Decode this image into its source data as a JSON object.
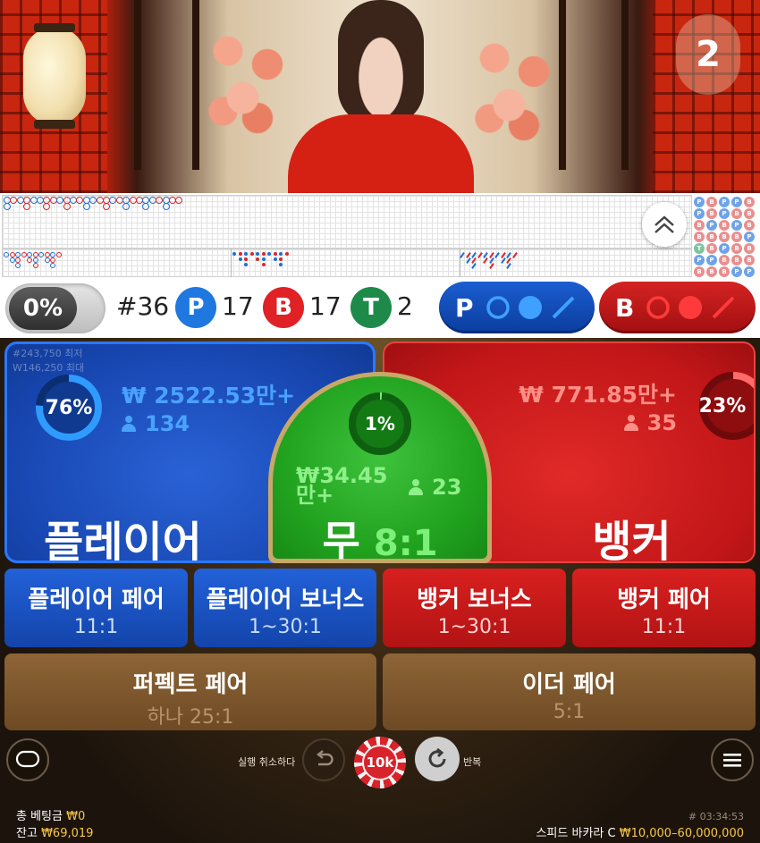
{
  "video": {
    "round_timer": "2"
  },
  "stats": {
    "percent_toggle": "0%",
    "round_number": "#36",
    "player_letter": "P",
    "player_count": "17",
    "banker_letter": "B",
    "banker_count": "17",
    "tie_letter": "T",
    "tie_count": "2",
    "ask_player_letter": "P",
    "ask_banker_letter": "B"
  },
  "bets": {
    "player": {
      "label": "플레이어",
      "amount": "₩ 2522.53만+",
      "players": "134",
      "percent": "76%",
      "percent_value": 0.76,
      "ghost_1": "#243,750 최저",
      "ghost_2": "W146,250 최대"
    },
    "tie": {
      "label": "무",
      "odds": "8:1",
      "amount": "₩34.45\n만+",
      "players": "23",
      "percent": "1%",
      "percent_value": 0.01
    },
    "banker": {
      "label": "뱅커",
      "amount": "₩ 771.85만+",
      "players": "35",
      "percent": "23%",
      "percent_value": 0.23
    },
    "player_pair": {
      "label": "플레이어 페어",
      "odds": "11:1"
    },
    "player_bonus": {
      "label": "플레이어 보너스",
      "odds": "1~30:1"
    },
    "banker_bonus": {
      "label": "뱅커 보너스",
      "odds": "1~30:1"
    },
    "banker_pair": {
      "label": "뱅커 페어",
      "odds": "11:1"
    },
    "perfect_pair": {
      "label": "퍼펙트 페어",
      "odds": "하나 25:1"
    },
    "either_pair": {
      "label": "이더 페어",
      "odds": "5:1"
    }
  },
  "controls": {
    "undo_label": "실행 취소하다",
    "chip_value": "10k",
    "repeat_label": "반복"
  },
  "footer": {
    "total_bet_label": "총 베팅금",
    "total_bet_value": "₩0",
    "balance_label": "잔고",
    "balance_value": "₩69,019",
    "game_id": "# 03:34:53",
    "table_name": "스피드 바카라 C",
    "table_limits": "₩10,000–60,000,000"
  },
  "colors": {
    "player": "#1746b0",
    "banker": "#c21618",
    "tie": "#21a21f",
    "chip_gold": "#f7c64a"
  },
  "icons": [
    "expand-up-icon",
    "chat-icon",
    "undo-icon",
    "repeat-icon",
    "menu-icon",
    "person-icon"
  ]
}
